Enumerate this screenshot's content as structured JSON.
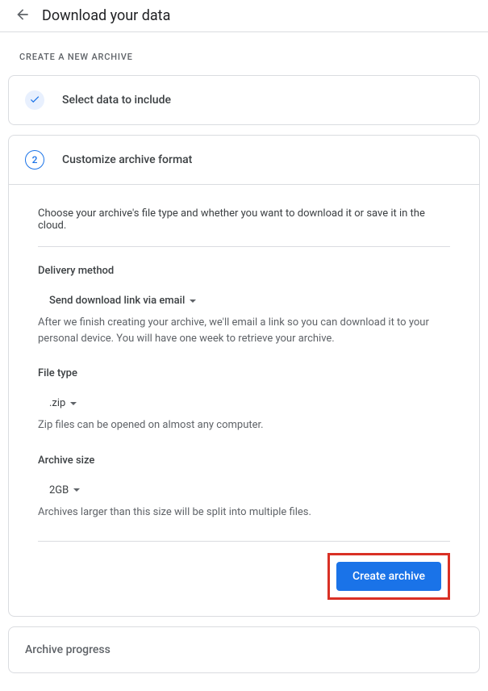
{
  "header": {
    "title": "Download your data"
  },
  "section_label": "CREATE A NEW ARCHIVE",
  "step1": {
    "title": "Select data to include"
  },
  "step2": {
    "number": "2",
    "title": "Customize archive format",
    "intro": "Choose your archive's file type and whether you want to download it or save it in the cloud.",
    "delivery": {
      "label": "Delivery method",
      "selected": "Send download link via email",
      "help": "After we finish creating your archive, we'll email a link so you can download it to your personal device. You will have one week to retrieve your archive."
    },
    "filetype": {
      "label": "File type",
      "selected": ".zip",
      "help": "Zip files can be opened on almost any computer."
    },
    "archivesize": {
      "label": "Archive size",
      "selected": "2GB",
      "help": "Archives larger than this size will be split into multiple files."
    },
    "create_button": "Create archive"
  },
  "step3": {
    "title": "Archive progress"
  }
}
